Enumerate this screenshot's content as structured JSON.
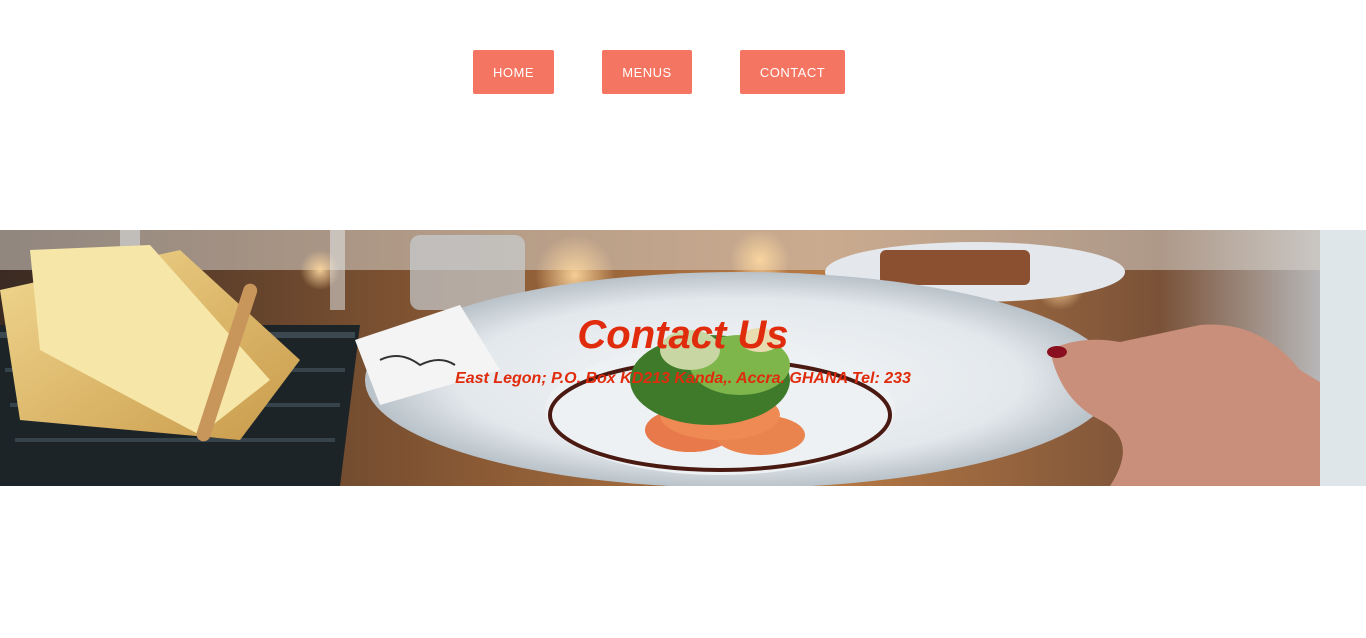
{
  "nav": {
    "home_label": "HOME",
    "menus_label": "MENUS",
    "contact_label": "CONTACT"
  },
  "hero": {
    "title": "Contact Us",
    "address": "East Legon; P.O. Box KD213 Kanda,. Accra. GHANA Tel: 233",
    "image": "restaurant-dish-photo"
  },
  "colors": {
    "nav_button": "#f47561",
    "nav_text": "#ffffff",
    "hero_text": "#e02b0c"
  }
}
